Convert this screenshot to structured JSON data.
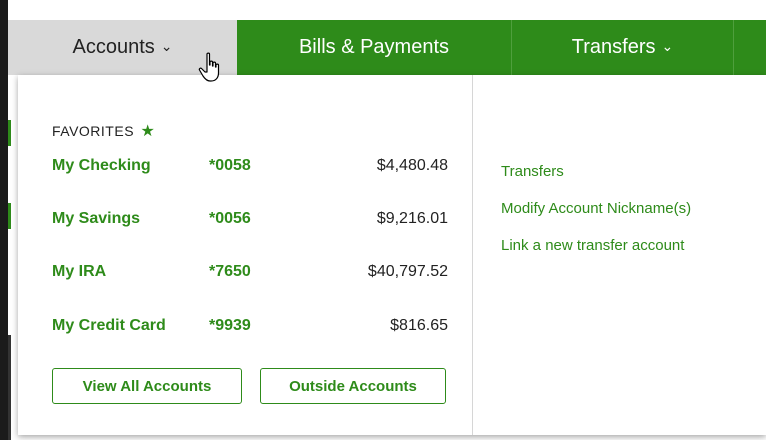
{
  "nav": {
    "items": [
      {
        "label": "Accounts",
        "has_dropdown": true,
        "active": true
      },
      {
        "label": "Bills & Payments",
        "has_dropdown": false,
        "active": false
      },
      {
        "label": "Transfers",
        "has_dropdown": true,
        "active": false
      }
    ]
  },
  "favorites": {
    "title": "FAVORITES",
    "accounts": [
      {
        "name": "My Checking",
        "number": "*0058",
        "balance": "$4,480.48"
      },
      {
        "name": "My Savings",
        "number": "*0056",
        "balance": "$9,216.01"
      },
      {
        "name": "My IRA",
        "number": "*7650",
        "balance": "$40,797.52"
      },
      {
        "name": "My Credit Card",
        "number": "*9939",
        "balance": "$816.65"
      }
    ]
  },
  "buttons": {
    "view_all": "View All Accounts",
    "outside": "Outside Accounts"
  },
  "links": {
    "transfers": "Transfers",
    "modify_nickname": "Modify Account Nickname(s)",
    "link_account": "Link a new transfer account"
  },
  "colors": {
    "brand_green": "#2e8b1a",
    "active_tab_bg": "#d9d9d9"
  }
}
